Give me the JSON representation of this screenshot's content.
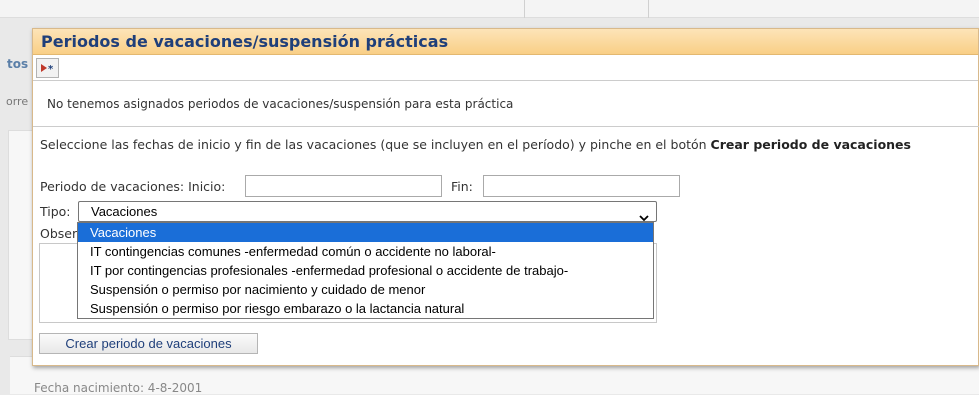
{
  "background": {
    "left_link_fragment": "tos",
    "left_text_fragment": "orre",
    "birth_date_text": "Fecha nacimiento: 4-8-2001"
  },
  "dialog": {
    "title": "Periodos de vacaciones/suspensión prácticas",
    "toolbar": {
      "expand_icon": "expand-arrow-icon"
    },
    "message": "No tenemos asignados periodos de vacaciones/suspensión para esta práctica",
    "instructions_prefix": "Seleccione las fechas de inicio y fin de las vacaciones (que se incluyen en el período) y pinche en el botón ",
    "instructions_bold": "Crear periodo de vacaciones",
    "form": {
      "period_label": "Periodo de vacaciones: Inicio:",
      "start_value": "",
      "end_label": "Fin:",
      "end_value": "",
      "type_label": "Tipo:",
      "type_selected": "Vacaciones",
      "observations_label_fragment": "Obser",
      "type_options": [
        "Vacaciones",
        "IT contingencias comunes -enfermedad común o accidente no laboral-",
        "IT por contingencias profesionales -enfermedad profesional o accidente de trabajo-",
        "Suspensión o permiso por nacimiento y cuidado de menor",
        "Suspensión o permiso por riesgo embarazo o la lactancia natural"
      ],
      "submit_label": "Crear periodo de vacaciones"
    }
  },
  "colors": {
    "title_bg": "#f9cf86",
    "title_text": "#1f3f7a",
    "selected_option_bg": "#1a6ed8"
  }
}
